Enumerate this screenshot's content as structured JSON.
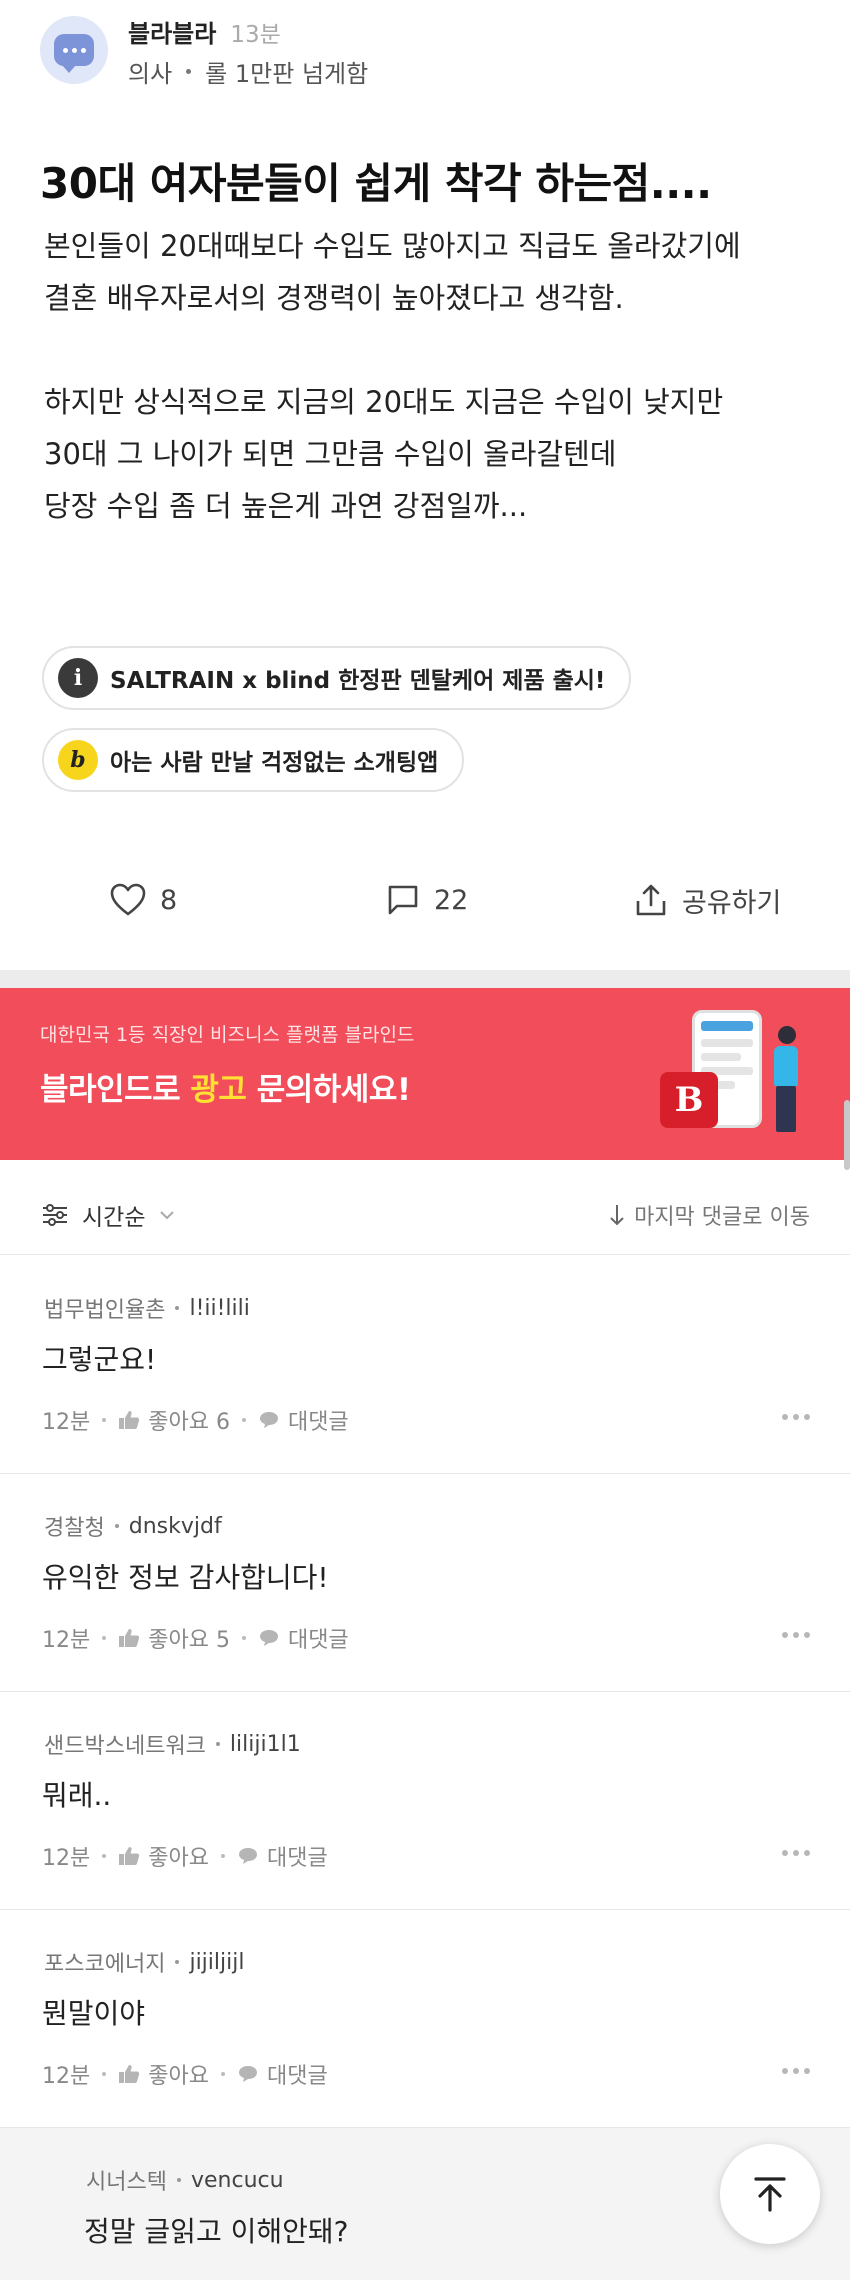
{
  "post": {
    "author": "블라블라",
    "time": "13분",
    "company": "의사",
    "topic": "롤 1만판 넘게함",
    "title": "30대 여자분들이 쉽게 착각 하는점....",
    "body": [
      "본인들이 20대때보다 수입도 많아지고 직급도 올라갔기에",
      "결혼 배우자로서의 경쟁력이 높아졌다고 생각함.",
      "",
      "하지만 상식적으로 지금의 20대도 지금은 수입이 낮지만",
      "30대 그 나이가 되면  그만큼 수입이 올라갈텐데",
      "당장 수입 좀 더 높은게 과연 강점일까..."
    ]
  },
  "chips": [
    {
      "icon": "info-icon",
      "glyph": "i",
      "label": "SALTRAIN x blind 한정판 덴탈케어 제품 출시!"
    },
    {
      "icon": "b-badge-icon",
      "glyph": "b",
      "label": "아는 사람 만날 걱정없는 소개팅앱"
    }
  ],
  "actions": {
    "likes": "8",
    "comments": "22",
    "share": "공유하기"
  },
  "ad": {
    "subtitle": "대한민국 1등 직장인 비즈니스 플랫폼 블라인드",
    "title_before": "블라인드로 ",
    "title_highlight": "광고",
    "title_after": " 문의하세요!",
    "logo_letter": "B",
    "accent": "#f24d5a",
    "highlight": "#ffe033"
  },
  "sort": {
    "label": "시간순",
    "jump": "마지막 댓글로 이동"
  },
  "comments": [
    {
      "company": "법무법인율촌",
      "nick": "l!ii!lili",
      "text": "그렇군요!",
      "time": "12분",
      "likes": "좋아요 6",
      "reply": "대댓글"
    },
    {
      "company": "경찰청",
      "nick": "dnskvjdf",
      "text": "유익한 정보 감사합니다!",
      "time": "12분",
      "likes": "좋아요 5",
      "reply": "대댓글"
    },
    {
      "company": "샌드박스네트워크",
      "nick": "liliji1l1",
      "text": "뭐래..",
      "time": "12분",
      "likes": "좋아요",
      "reply": "대댓글"
    },
    {
      "company": "포스코에너지",
      "nick": "jijiljijl",
      "text": "뭔말이야",
      "time": "12분",
      "likes": "좋아요",
      "reply": "대댓글"
    },
    {
      "company": "시너스텍",
      "nick": "vencucu",
      "text": "정말 글읽고 이해안돼?",
      "time": "",
      "likes": "",
      "reply": ""
    }
  ]
}
